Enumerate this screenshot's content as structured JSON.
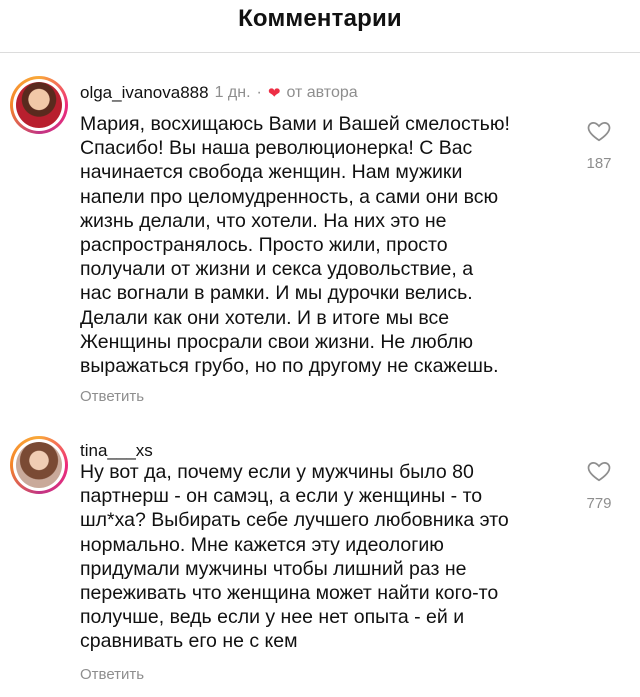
{
  "header": {
    "title": "Комментарии"
  },
  "comments": [
    {
      "username": "olga_ivanova888",
      "time": "1 дн.",
      "separator": "·",
      "author_note": "от автора",
      "text": "Мария, восхищаюсь Вами и Вашей смелостью!\nСпасибо! Вы наша революционерка! С Вас\nначинается свобода женщин. Нам мужики\nнапели про целомудренность, а сами они всю\nжизнь делали, что хотели. На них это не\nраспространялось. Просто жили, просто\nполучали от жизни и секса удовольствие, а\nнас вогнали в рамки. И мы дурочки велись.\nДелали как они хотели. И в итоге мы все\nЖенщины просрали свои жизни. Не люблю\nвыражаться грубо, но по другому не скажешь.",
      "reply_label": "Ответить",
      "likes": "187",
      "like_icon": "heart-outline-icon"
    },
    {
      "username": "tina___xs",
      "text": "Ну вот да, почему если у мужчины было 80\nпартнерш - он самэц, а если у женщины - то\nшл*ха? Выбирать себе лучшего любовника это\nнормально. Мне кажется эту идеологию\nпридумали мужчины чтобы лишний раз не\nпереживать что женщина может найти кого-то\nполучше, ведь если у нее нет опыта - ей и\nсравнивать его не с кем",
      "reply_label": "Ответить",
      "likes": "779",
      "like_icon": "heart-outline-icon"
    }
  ],
  "colors": {
    "author_heart": "#ed2e45",
    "secondary_text": "#8e8e8e",
    "story_ring": "#ee2a7b"
  }
}
